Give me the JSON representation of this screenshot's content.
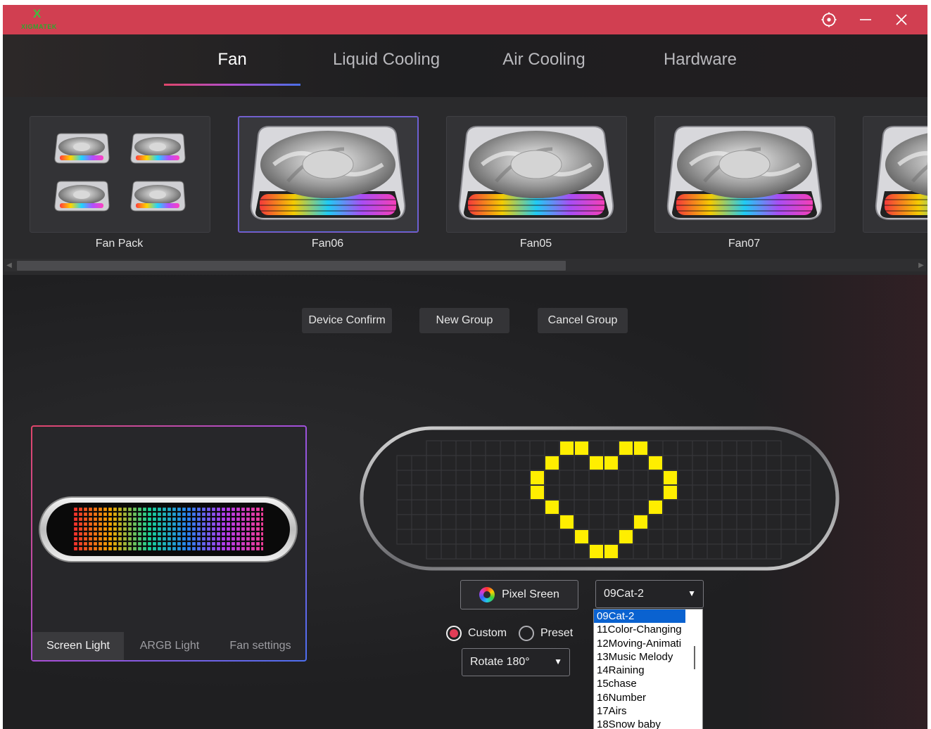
{
  "app": {
    "logo_text": "XIGMATEK",
    "colors": {
      "titlebar": "#d13f51",
      "accent_gradient": [
        "#e0466a",
        "#a54fd8",
        "#4d6ff0"
      ],
      "pixel_on": "#ffee00"
    }
  },
  "titlebar": {
    "buttons": [
      {
        "icon": "settings-target-icon"
      },
      {
        "icon": "minimize-icon"
      },
      {
        "icon": "close-icon"
      }
    ]
  },
  "tabs": [
    {
      "label": "Fan",
      "active": true
    },
    {
      "label": "Liquid Cooling",
      "active": false
    },
    {
      "label": "Air Cooling",
      "active": false
    },
    {
      "label": "Hardware",
      "active": false
    }
  ],
  "devices": [
    {
      "label": "Fan Pack",
      "selected": false
    },
    {
      "label": "Fan06",
      "selected": true
    },
    {
      "label": "Fan05",
      "selected": false
    },
    {
      "label": "Fan07",
      "selected": false
    }
  ],
  "actions": {
    "device_confirm": "Device Confirm",
    "new_group": "New Group",
    "cancel_group": "Cancel Group"
  },
  "preview_tabs": [
    {
      "label": "Screen Light",
      "active": true
    },
    {
      "label": "ARGB Light",
      "active": false
    },
    {
      "label": "Fan settings",
      "active": false
    }
  ],
  "screen": {
    "pixel_button": "Pixel Sreen",
    "effect_select": "09Cat-2",
    "mode_custom": "Custom",
    "mode_preset": "Preset",
    "selected_mode": "Custom",
    "rotate_select": "Rotate 180°",
    "effect_options": [
      "09Cat-2",
      "11Color-Changing",
      "12Moving-Animati",
      "13Music Melody",
      "14Raining",
      "15chase",
      "16Number",
      "17Airs",
      "18Snow baby"
    ]
  }
}
